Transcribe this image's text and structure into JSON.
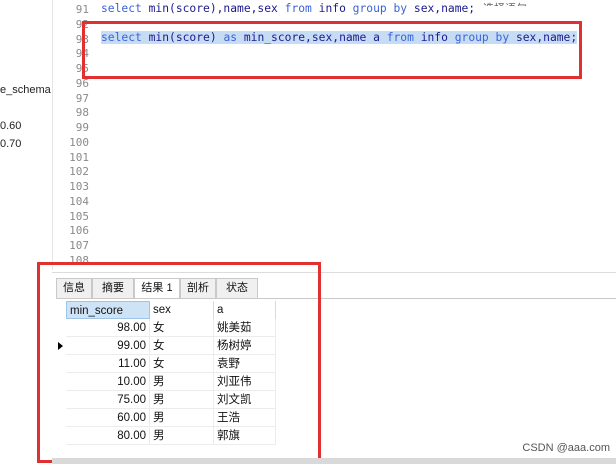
{
  "left_tree": {
    "items": [
      "e_schema",
      "0.60",
      "0.70"
    ]
  },
  "editor": {
    "line_numbers": [
      "91",
      "92",
      "93",
      "94",
      "95",
      "96",
      "97",
      "98",
      "99",
      "100",
      "101",
      "102",
      "103",
      "104",
      "105",
      "106",
      "107",
      "108"
    ],
    "line91": {
      "p1": "select ",
      "p2": "min(score),name,sex ",
      "p3": "from",
      "p4": " info ",
      "p5": "group",
      "p6": " by",
      "p7": " sex,name;"
    },
    "line93": {
      "p1": "select",
      "p2": " min(score) ",
      "p3": "as",
      "p4": " min_score,sex,name a ",
      "p5": "from",
      "p6": " info ",
      "p7": "group",
      "p8": " by",
      "p9": " sex,name;"
    },
    "tooltip_partial": "选择语句"
  },
  "panel": {
    "tabs": [
      "信息",
      "摘要",
      "结果 1",
      "剖析",
      "状态"
    ],
    "active_tab": "结果 1",
    "columns": [
      "min_score",
      "sex",
      "a"
    ],
    "rows": [
      [
        "98.00",
        "女",
        "姚美茹"
      ],
      [
        "99.00",
        "女",
        "杨树婷"
      ],
      [
        "11.00",
        "女",
        "袁野"
      ],
      [
        "10.00",
        "男",
        "刘亚伟"
      ],
      [
        "75.00",
        "男",
        "刘文凯"
      ],
      [
        "60.00",
        "男",
        "王浩"
      ],
      [
        "80.00",
        "男",
        "郭旗"
      ]
    ],
    "current_row": 1
  },
  "watermark": "CSDN @aaa.com",
  "colors": {
    "highlight_border": "#e0302f",
    "keyword": "#3b62d9",
    "selection": "#c6dcf5"
  }
}
